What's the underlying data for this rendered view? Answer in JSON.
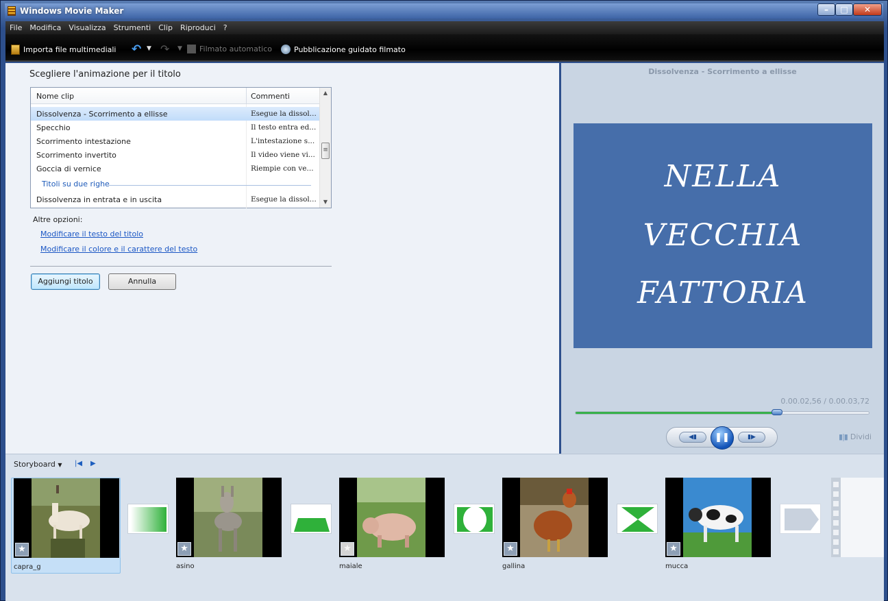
{
  "window": {
    "title": "Windows Movie Maker"
  },
  "menu": [
    "File",
    "Modifica",
    "Visualizza",
    "Strumenti",
    "Clip",
    "Riproduci",
    "?"
  ],
  "toolbar": {
    "import_label": "Importa file multimediali",
    "auto_movie_label": "Filmato automatico",
    "publish_label": "Pubblicazione guidato filmato"
  },
  "task": {
    "title": "Scegliere l'animazione per il titolo",
    "columns": {
      "name": "Nome clip",
      "comments": "Commenti"
    },
    "rows": [
      {
        "name": "Dissolvenza - Scorrimento a ellisse",
        "comment": "Esegue la dissol...",
        "selected": true
      },
      {
        "name": "Specchio",
        "comment": "Il testo entra ed..."
      },
      {
        "name": "Scorrimento intestazione",
        "comment": "L'intestazione s..."
      },
      {
        "name": "Scorrimento invertito",
        "comment": "Il video viene vi..."
      },
      {
        "name": "Goccia di vernice",
        "comment": "Riempie con ve..."
      }
    ],
    "group_label": "Titoli su due righe",
    "last_row": {
      "name": "Dissolvenza in entrata e in uscita",
      "comment": "Esegue la dissol..."
    },
    "other_options_label": "Altre opzioni:",
    "links": [
      "Modificare il testo del titolo",
      "Modificare il colore e il carattere del testo"
    ],
    "add_button": "Aggiungi titolo",
    "cancel_button": "Annulla"
  },
  "preview": {
    "title": "Dissolvenza - Scorrimento a ellisse",
    "text_lines": [
      "NELLA",
      "VECCHIA",
      "FATTORIA"
    ],
    "time": "0.00.02,56 / 0.00.03,72",
    "progress": 0.688,
    "split_label": "Dividi"
  },
  "storyboard": {
    "label": "Storyboard",
    "clips": [
      {
        "name": "capra_g",
        "selected": true
      },
      {
        "name": "asino"
      },
      {
        "name": "maiale"
      },
      {
        "name": "gallina"
      },
      {
        "name": "mucca"
      }
    ]
  },
  "colors": {
    "accent_link": "#1a56c4",
    "title_bg": "#466eaa",
    "progress": "#37b04a"
  }
}
